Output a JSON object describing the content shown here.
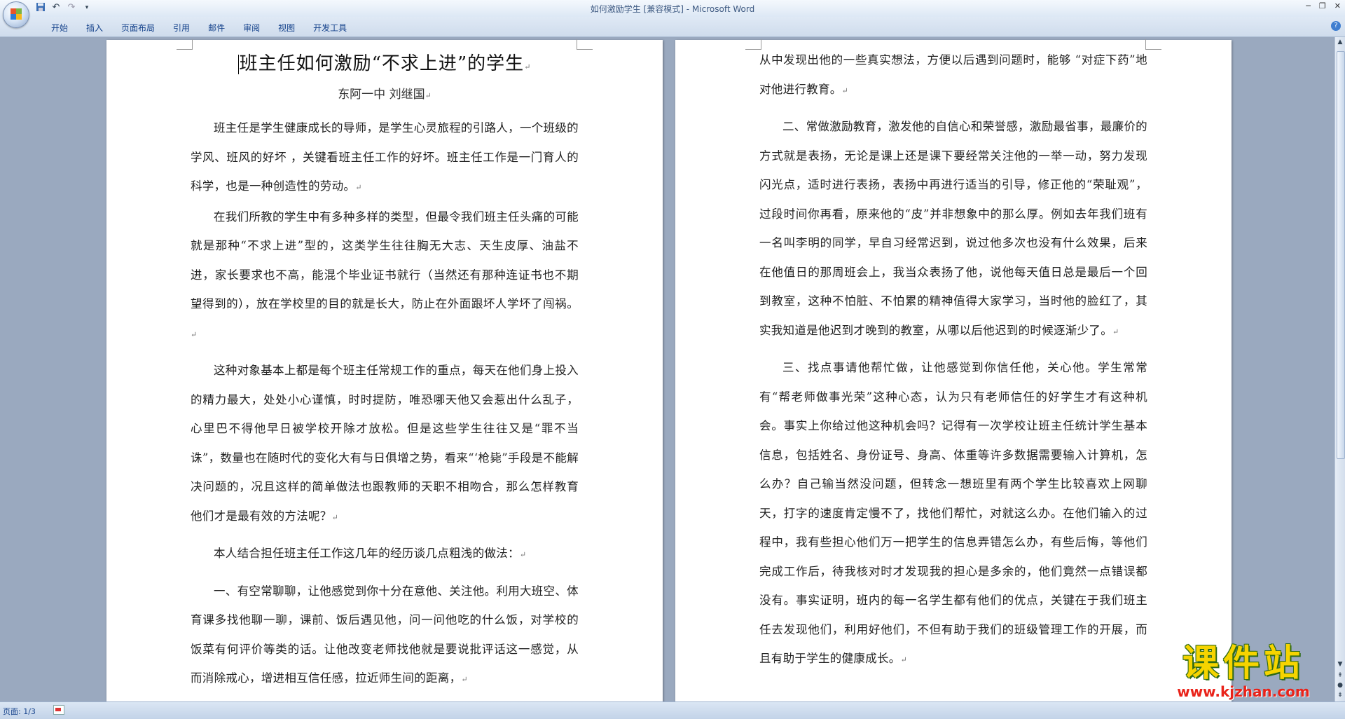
{
  "window": {
    "title": "如何激励学生 [兼容模式] - Microsoft Word"
  },
  "ribbon": {
    "tabs": [
      "开始",
      "插入",
      "页面布局",
      "引用",
      "邮件",
      "审阅",
      "视图",
      "开发工具"
    ]
  },
  "document": {
    "title": "班主任如何激励“不求上进”的学生",
    "author": "东阿一中  刘继国",
    "left_paragraphs": [
      "班主任是学生健康成长的导师，是学生心灵旅程的引路人，一个班级的学风、班风的好坏 ，关键看班主任工作的好坏。班主任工作是一门育人的科学，也是一种创造性的劳动。",
      "在我们所教的学生中有多种多样的类型，但最令我们班主任头痛的可能就是那种“不求上进”型的，这类学生往往胸无大志、天生皮厚、油盐不进，家长要求也不高，能混个毕业证书就行（当然还有那种连证书也不期望得到的），放在学校里的目的就是长大，防止在外面跟坏人学坏了闯祸。",
      "这种对象基本上都是每个班主任常规工作的重点，每天在他们身上投入的精力最大，处处小心谨慎，时时提防，唯恐哪天他又会惹出什么乱子，心里巴不得他早日被学校开除才放松。但是这些学生往往又是“罪不当诛”，数量也在随时代的变化大有与日俱增之势，看来“‘枪毙”手段是不能解决问题的，况且这样的简单做法也跟教师的天职不相吻合，那么怎样教育他们才是最有效的方法呢？",
      "本人结合担任班主任工作这几年的经历谈几点粗浅的做法：",
      "一、有空常聊聊，让他感觉到你十分在意他、关注他。利用大班空、体育课多找他聊一聊，课前、饭后遇见他，问一问他吃的什么饭，对学校的饭菜有何评价等类的话。让他改变老师找他就是要说批评话这一感觉，从而消除戒心，增进相互信任感，拉近师生间的距离，"
    ],
    "right_paragraphs": [
      "从中发现出他的一些真实想法，方便以后遇到问题时，能够 “对症下药”地对他进行教育。",
      "二、常做激励教育，激发他的自信心和荣誉感，激励最省事，最廉价的方式就是表扬，无论是课上还是课下要经常关注他的一举一动，努力发现闪光点，适时进行表扬，表扬中再进行适当的引导，修正他的“荣耻观”，过段时间你再看，原来他的“皮”并非想象中的那么厚。例如去年我们班有一名叫李明的同学，早自习经常迟到，说过他多次也没有什么效果，后来在他值日的那周班会上，我当众表扬了他，说他每天值日总是最后一个回到教室，这种不怕脏、不怕累的精神值得大家学习，当时他的脸红了，其实我知道是他迟到才晚到的教室，从哪以后他迟到的时候逐渐少了。",
      "三、找点事请他帮忙做，让他感觉到你信任他，关心他。学生常常有“帮老师做事光荣”这种心态，认为只有老师信任的好学生才有这种机会。事实上你给过他这种机会吗？记得有一次学校让班主任统计学生基本信息，包括姓名、身份证号、身高、体重等许多数据需要输入计算机，怎么办？自己输当然没问题，但转念一想班里有两个学生比较喜欢上网聊天，打字的速度肯定慢不了，找他们帮忙，对就这么办。在他们输入的过程中，我有些担心他们万一把学生的信息弄错怎么办，有些后悔，等他们完成工作后，待我核对时才发现我的担心是多余的，他们竟然一点错误都没有。事实证明，班内的每一名学生都有他们的优点，关键在于我们班主任去发现他们，利用好他们，不但有助于我们的班级管理工作的开展，而且有助于学生的健康成长。"
    ],
    "paragraph_mark": "↵"
  },
  "statusbar": {
    "page_info": "页面: 1/3"
  },
  "watermark": {
    "text": "课件站",
    "url": "www.kjzhan.com"
  },
  "colors": {
    "ribbon_text": "#15428b",
    "title_text": "#3e5a82",
    "watermark_yellow": "#f6d400",
    "watermark_red": "#e9231a"
  }
}
